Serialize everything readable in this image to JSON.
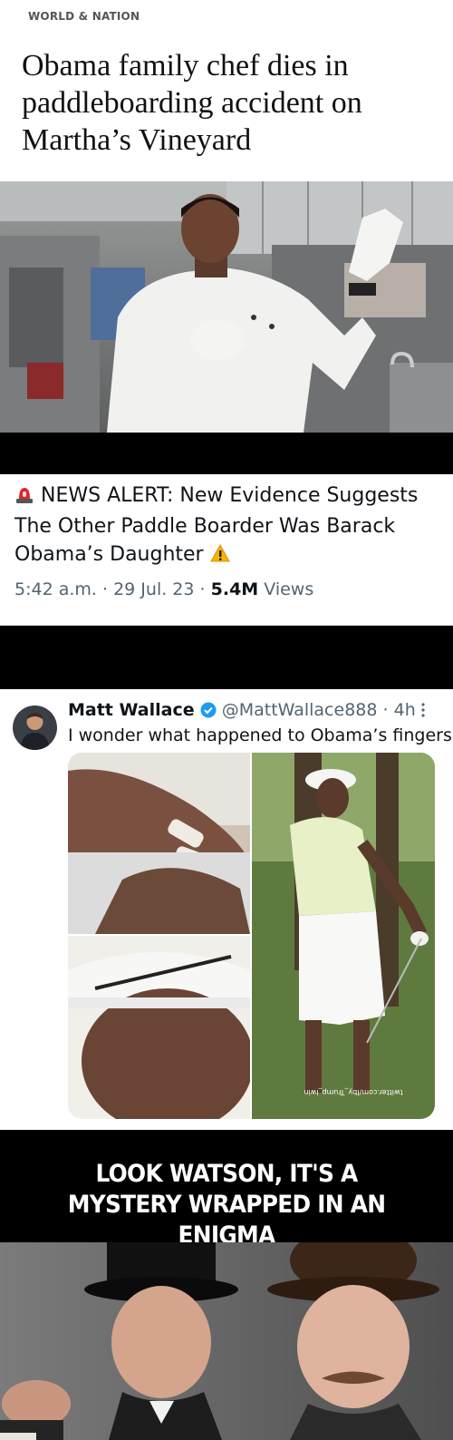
{
  "article": {
    "kicker": "WORLD & NATION",
    "headline": "Obama family chef dies in paddleboarding accident on Martha’s Vineyard"
  },
  "tweet_alert": {
    "text_before": "NEWS ALERT: New Evidence Suggests The Other Paddle Boarder Was Barack Obama’s Daughter",
    "icon_siren": "rotating-light-icon",
    "icon_warning": "warning-icon",
    "time": "5:42 a.m.",
    "sep1": "·",
    "date": "29 Jul. 23",
    "sep2": "·",
    "views_count": "5.4M",
    "views_label": "Views"
  },
  "tweet_post": {
    "name": "Matt Wallace",
    "verified_icon": "verified-badge-icon",
    "handle": "@MattWallace888",
    "sep": "·",
    "age": "4h",
    "more_icon": "more-options-icon",
    "text": "I wonder what happened to Obama’s fingers",
    "media_watermark": "twitter.com/Iby_Trump_lwin"
  },
  "caption": {
    "line1": "LOOK WATSON, IT'S A",
    "line2": "MYSTERY WRAPPED IN AN ENIGMA"
  },
  "colors": {
    "tweet_text": "#0f1419",
    "tweet_meta": "#536471",
    "verified_blue": "#1d9bf0",
    "caption_bg": "#000000"
  }
}
